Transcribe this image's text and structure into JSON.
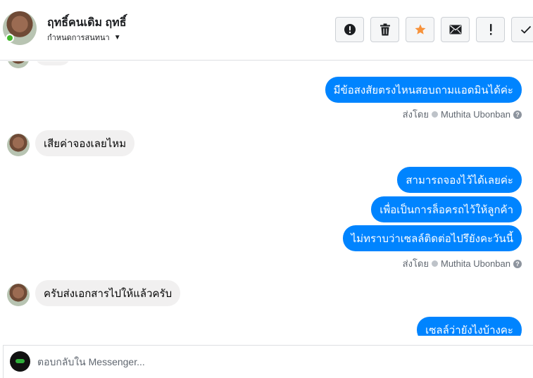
{
  "header": {
    "contact_name": "ฤทธิ์คนเดิม ฤทธิ์",
    "assign_label": "กำหนดการสนทนา"
  },
  "actions": [
    {
      "icon": "alert-circle-icon",
      "name": "mark-spam-button"
    },
    {
      "icon": "trash-icon",
      "name": "delete-button"
    },
    {
      "icon": "star-icon",
      "name": "star-button"
    },
    {
      "icon": "envelope-icon",
      "name": "mark-unread-button"
    },
    {
      "icon": "exclamation-icon",
      "name": "follow-up-button"
    },
    {
      "icon": "check-icon",
      "name": "mark-done-button"
    }
  ],
  "colors": {
    "outgoing_bubble": "#0084ff",
    "incoming_bubble": "#f1f0f0",
    "star": "#f7923b"
  },
  "messages": {
    "m1": "มีข้อสงสัยตรงไหนสอบถามแอดมินได้ค่ะ",
    "sent_by_1": "ส่งโดย",
    "sender_1": "Muthita Ubonban",
    "m2": "เสียค่าจองเลยไหม",
    "m3": "สามารถจองไว้ได้เลยค่ะ",
    "m4": "เพื่อเป็นการล็อครถไว้ให้ลูกค้า",
    "m5": "ไม่ทราบว่าเซลล์ติดต่อไปรึยังคะวันนี้",
    "sent_by_2": "ส่งโดย",
    "sender_2": "Muthita Ubonban",
    "m6": "ครับส่งเอกสารไปให้แล้วครับ",
    "m7": "เซลล์ว่ายังไงบ้างคะ"
  },
  "composer": {
    "placeholder": "ตอบกลับใน Messenger..."
  }
}
